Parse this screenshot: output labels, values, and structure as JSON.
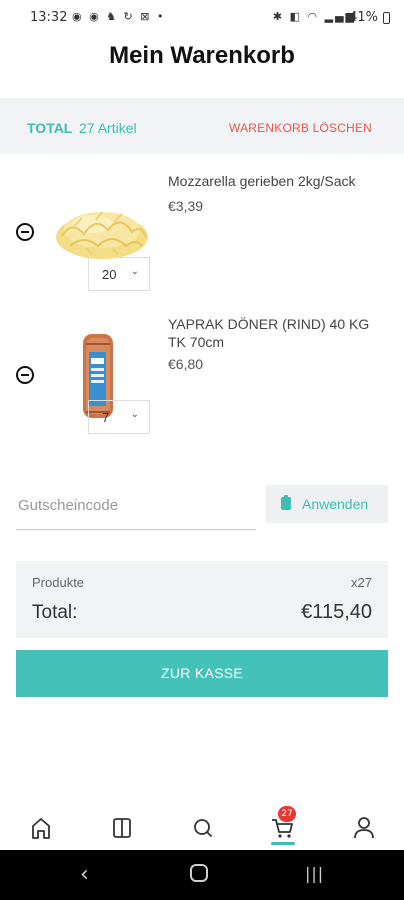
{
  "status_bar": {
    "time": "13:32",
    "notification_icons": [
      "whatsapp-icon",
      "facebook-icon",
      "app-icon",
      "sync-icon",
      "screenshot-icon",
      "dot-icon"
    ],
    "battery": "41%"
  },
  "header": {
    "title": "Mein Warenkorb"
  },
  "summary": {
    "total_label": "TOTAL",
    "count": "27 Artikel",
    "clear_label": "WARENKORB LÖSCHEN"
  },
  "cart": {
    "items": [
      {
        "name": "Mozzarella gerieben 2kg/Sack",
        "price": "€3,39",
        "qty": "20",
        "image": "grated-cheese-image"
      },
      {
        "name": "YAPRAK DÖNER (RIND) 40 KG TK 70cm",
        "price": "€6,80",
        "qty": "7",
        "image": "doner-package-image"
      }
    ]
  },
  "coupon": {
    "placeholder": "Gutscheincode",
    "value": "",
    "apply_label": "Anwenden"
  },
  "totals": {
    "products_label": "Produkte",
    "products_count": "x27",
    "total_label": "Total:",
    "total_value": "€115,40"
  },
  "checkout": {
    "label": "ZUR KASSE"
  },
  "bottom_nav": {
    "items": [
      "home-icon",
      "catalog-icon",
      "search-icon",
      "cart-icon",
      "account-icon"
    ],
    "cart_badge": "27",
    "active": "cart-icon"
  },
  "colors": {
    "accent": "#44c1b8",
    "danger": "#e5574f",
    "badge": "#e53935"
  }
}
